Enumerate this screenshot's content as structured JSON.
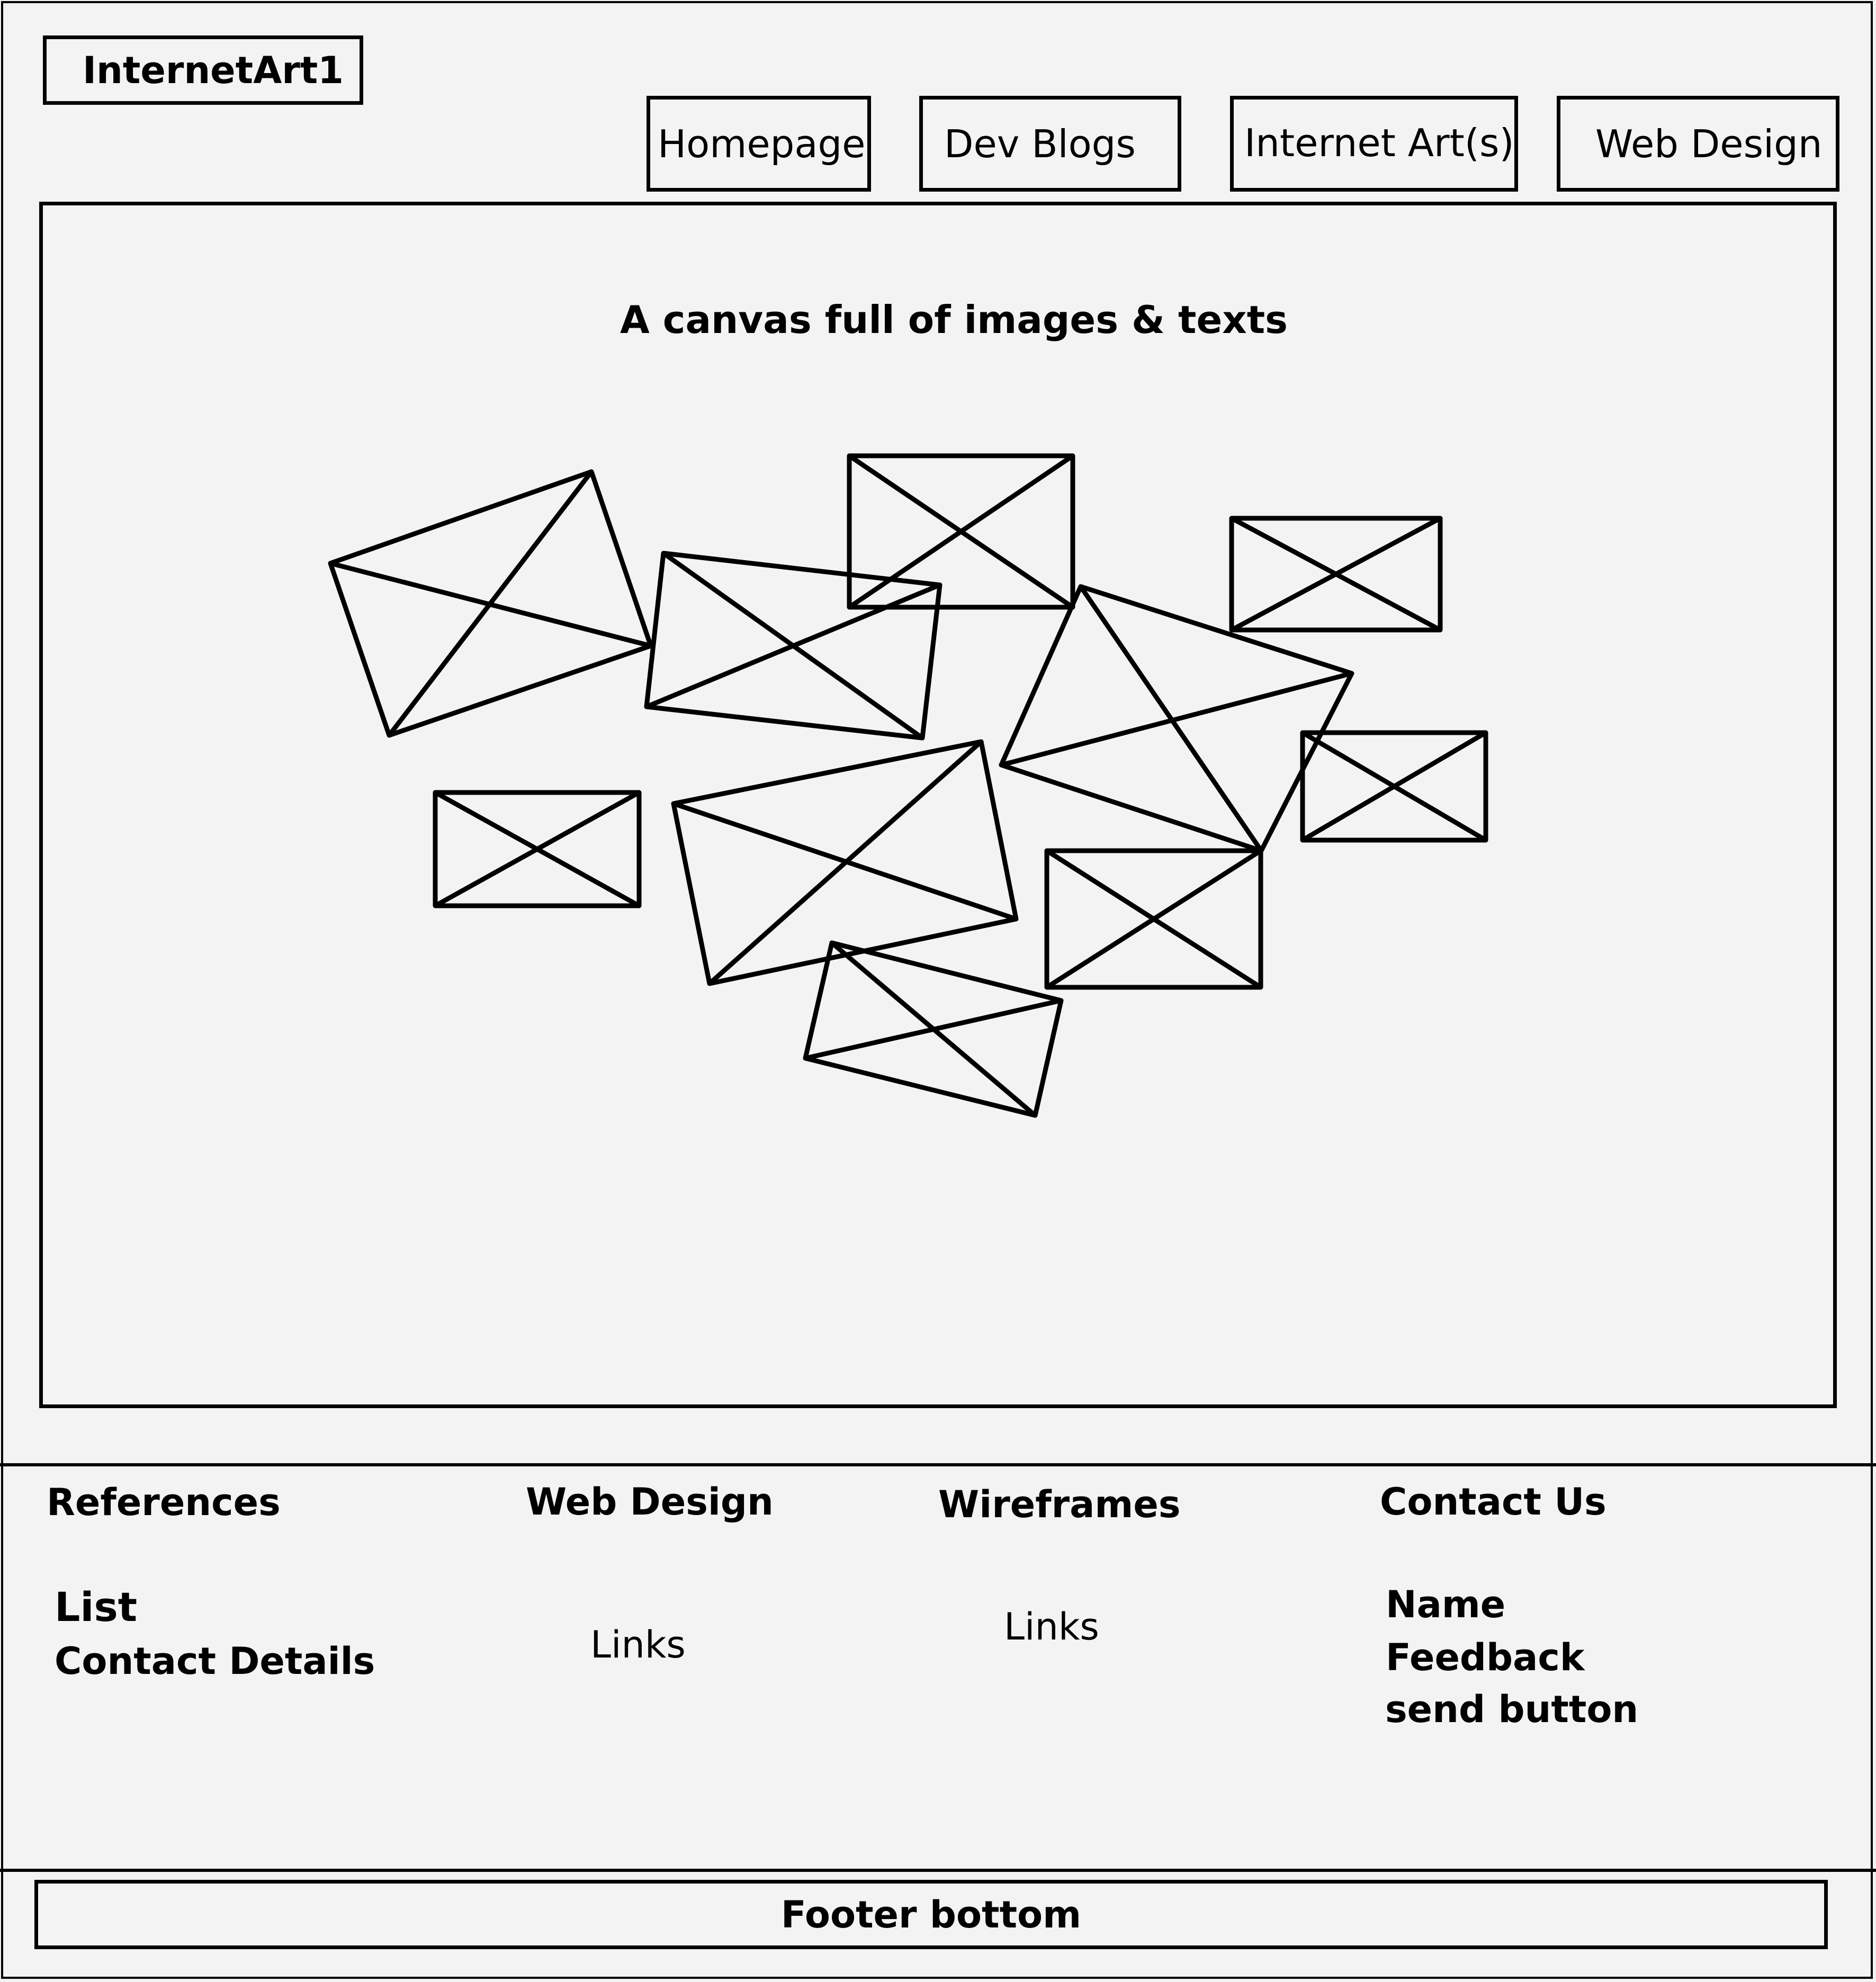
{
  "header": {
    "logo": "InternetArt1",
    "nav": [
      {
        "label": "Homepage"
      },
      {
        "label": "Dev Blogs"
      },
      {
        "label": "Internet Art(s)"
      },
      {
        "label": "Web Design"
      }
    ]
  },
  "canvas": {
    "title": "A canvas full of images & texts"
  },
  "footer": {
    "references": {
      "heading": "References",
      "items": [
        "List",
        "Contact Details"
      ]
    },
    "web_design": {
      "heading": "Web Design",
      "link": "Links"
    },
    "wireframes": {
      "heading": "Wireframes",
      "link": "Links"
    },
    "contact": {
      "heading": "Contact Us",
      "items": [
        "Name",
        "Feedback",
        "send button"
      ]
    },
    "bottom": "Footer bottom"
  }
}
